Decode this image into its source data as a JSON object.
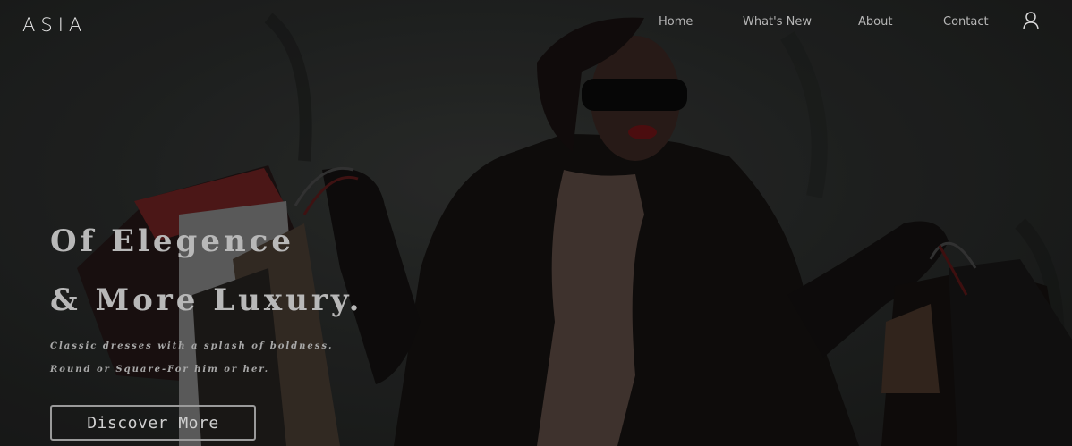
{
  "brand": {
    "logo": "ASIA"
  },
  "nav": {
    "items": [
      {
        "label": "Home"
      },
      {
        "label": "What's New"
      },
      {
        "label": "About"
      },
      {
        "label": "Contact"
      }
    ],
    "account_icon": "user-icon"
  },
  "hero": {
    "headline_line1": "Of Elegence",
    "headline_line2": "& More Luxury.",
    "subtext_line1": "Classic dresses with a splash of boldness.",
    "subtext_line2": "Round or Square-For him or her.",
    "cta_label": "Discover More",
    "background_image": "woman-with-shopping-bags-photo"
  },
  "colors": {
    "background": "#1f2120",
    "headline": "#b8b8b8",
    "nav_text": "#b6b6b6",
    "logo": "#e8e8e8"
  }
}
